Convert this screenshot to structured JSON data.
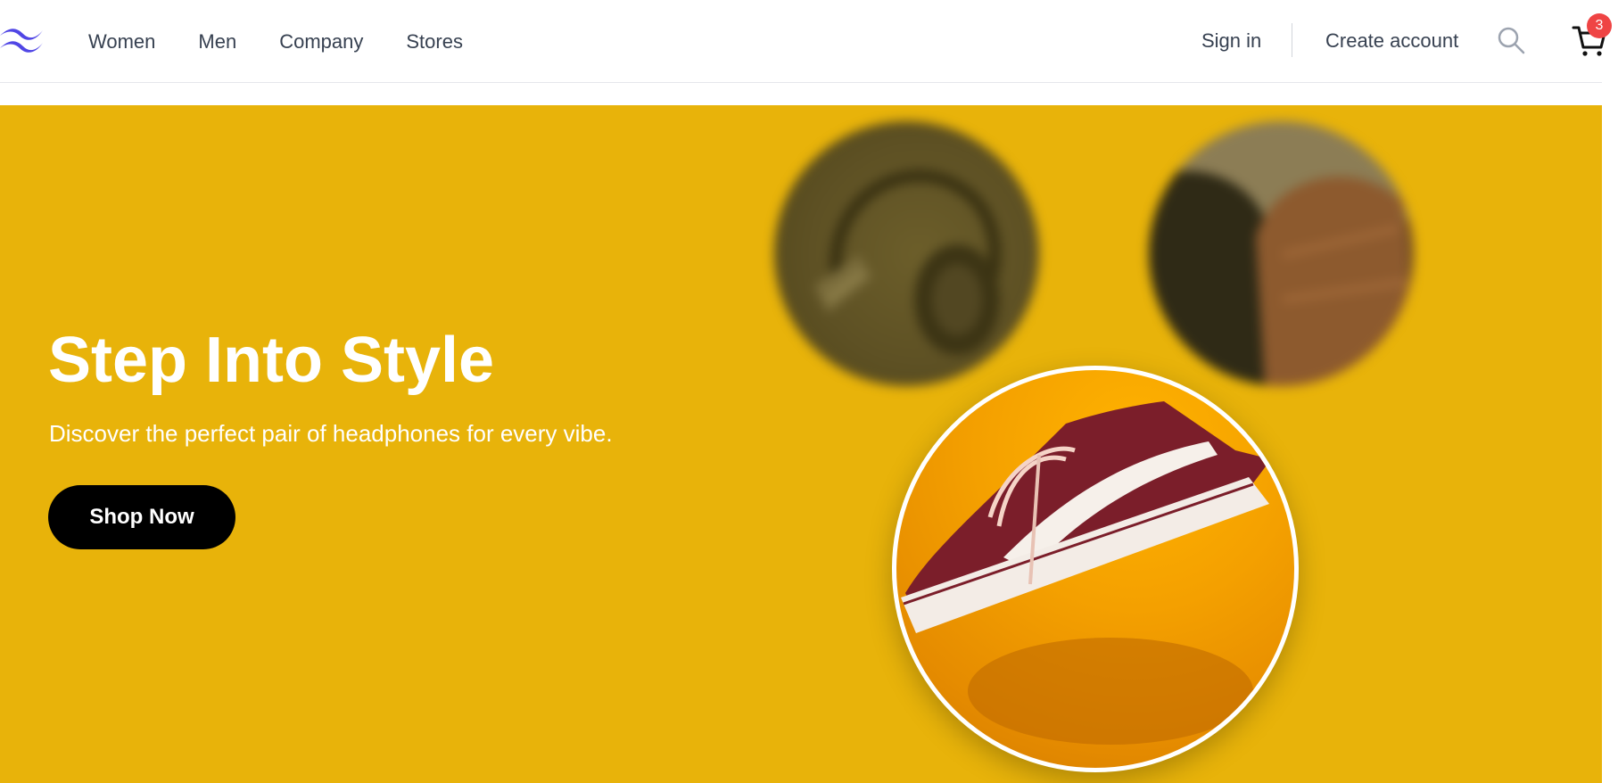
{
  "nav": {
    "logo_icon": "wave-logo-icon",
    "links": [
      "Women",
      "Men",
      "Company",
      "Stores"
    ],
    "sign_in": "Sign in",
    "create_account": "Create account",
    "search_icon": "search-icon",
    "cart_icon": "cart-icon",
    "cart_count": "3"
  },
  "hero": {
    "title": "Step Into Style",
    "subtitle": "Discover the perfect pair of headphones for every vibe.",
    "cta_label": "Shop Now",
    "background_color": "#e8b30a",
    "images": [
      {
        "subject": "headphones",
        "state": "blurred"
      },
      {
        "subject": "gloves",
        "state": "blurred"
      },
      {
        "subject": "sneaker",
        "state": "focused"
      }
    ]
  }
}
